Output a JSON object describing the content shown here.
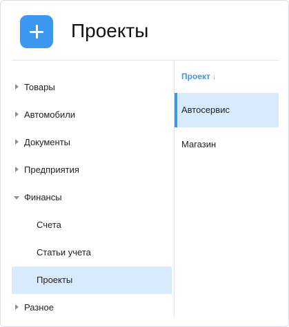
{
  "header": {
    "title": "Проекты",
    "add_icon": "plus-icon",
    "accent_color": "#3b97f0"
  },
  "sidebar": {
    "items": [
      {
        "label": "Товары",
        "expanded": false
      },
      {
        "label": "Автомобили",
        "expanded": false
      },
      {
        "label": "Документы",
        "expanded": false
      },
      {
        "label": "Предприятия",
        "expanded": false
      },
      {
        "label": "Финансы",
        "expanded": true,
        "children": [
          {
            "label": "Счета"
          },
          {
            "label": "Статьи учета"
          },
          {
            "label": "Проекты",
            "selected": true
          }
        ]
      },
      {
        "label": "Разное",
        "expanded": false
      }
    ],
    "selection_color": "#d8eafd"
  },
  "list": {
    "column_header": "Проект",
    "sort_icon": "↓",
    "rows": [
      {
        "label": "Автосервис",
        "selected": true
      },
      {
        "label": "Магазин",
        "selected": false
      }
    ]
  }
}
